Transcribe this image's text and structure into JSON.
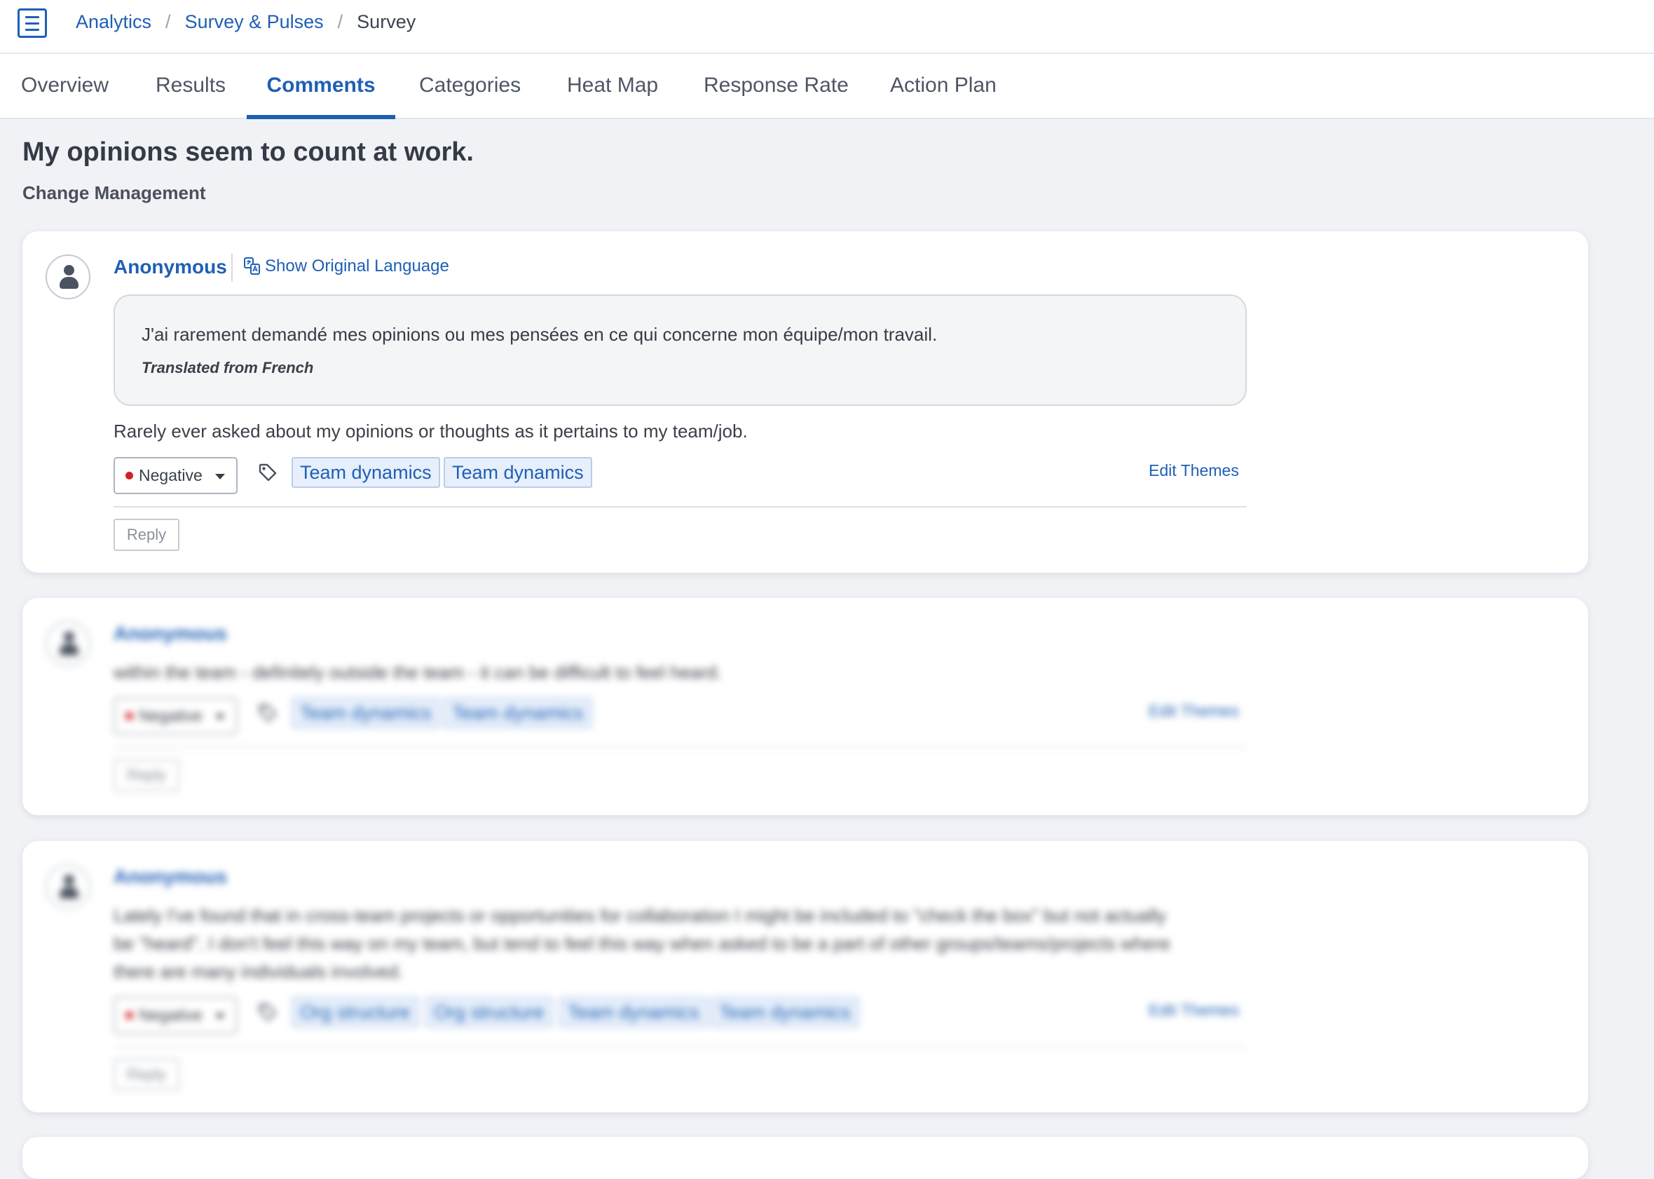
{
  "breadcrumb": {
    "items": [
      "Analytics",
      "Survey & Pulses"
    ],
    "current": "Survey",
    "separator": "/"
  },
  "tabs": [
    "Overview",
    "Results",
    "Comments",
    "Categories",
    "Heat Map",
    "Response Rate",
    "Action Plan"
  ],
  "active_tab": "Comments",
  "question": {
    "title": "My opinions seem to count at work.",
    "category": "Change Management"
  },
  "comments": [
    {
      "author": "Anonymous",
      "show_original_label": "Show Original Language",
      "original_text": "J'ai rarement demandé mes opinions ou mes pensées en ce qui concerne mon équipe/mon travail.",
      "translated_note": "Translated from French",
      "text": "Rarely ever asked about my opinions or thoughts as it pertains to my team/job.",
      "sentiment": "Negative",
      "themes": [
        "Team dynamics",
        "Team dynamics"
      ],
      "edit_themes_label": "Edit Themes",
      "reply_label": "Reply"
    },
    {
      "author": "Anonymous",
      "text": "within the team - definitely outside the team - it can be difficult to feel heard.",
      "sentiment": "Negative",
      "themes": [
        "Team dynamics",
        "Team dynamics"
      ],
      "edit_themes_label": "Edit Themes",
      "reply_label": "Reply"
    },
    {
      "author": "Anonymous",
      "text_lines": [
        "Lately I've found that in cross-team projects or opportunities for collaboration I might be included to \"check the box\" but not actually",
        "be \"heard\". I don't feel this way on my team, but tend to feel this way when asked to be a part of other groups/teams/projects where",
        "there are many individuals involved."
      ],
      "sentiment": "Negative",
      "themes": [
        "Org structure",
        "Org structure",
        "Team dynamics",
        "Team dynamics"
      ],
      "edit_themes_label": "Edit Themes",
      "reply_label": "Reply"
    }
  ],
  "colors": {
    "accent": "#1f5fb5",
    "negative": "#d3202a",
    "page_bg": "#f1f2f6",
    "tag_bg": "#e6effb"
  },
  "icons": [
    "menu-icon",
    "user-avatar-icon",
    "translate-icon",
    "tag-icon",
    "caret-down-icon"
  ]
}
